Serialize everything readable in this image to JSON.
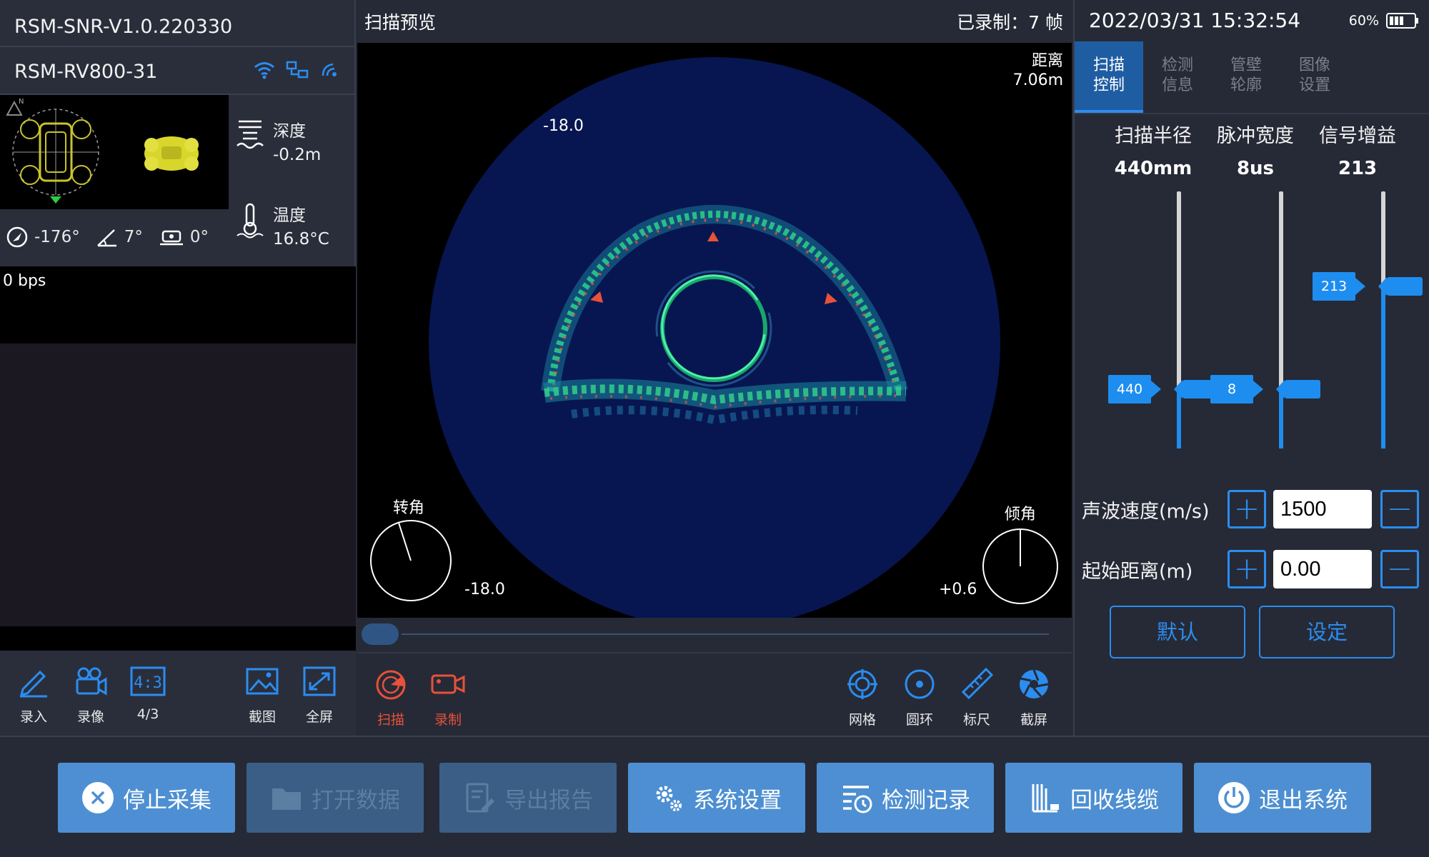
{
  "left": {
    "firmware_version": "RSM-SNR-V1.0.220330",
    "device_name": "RSM-RV800-31",
    "depth": {
      "label": "深度",
      "value": "-0.2m"
    },
    "temperature": {
      "label": "温度",
      "value": "16.8°C"
    },
    "heading": "-176°",
    "pitch": "7°",
    "roll": "0°",
    "bitrate": "0 bps",
    "toolbar": {
      "enter": "录入",
      "record": "录像",
      "aspect": "4/3",
      "aspect_icon_text": "4:3",
      "snapshot": "截图",
      "fullscreen": "全屏"
    }
  },
  "center": {
    "title": "扫描预览",
    "recorded": "已录制：7 帧",
    "distance_label": "距离",
    "distance_value": "7.06m",
    "scale_top": "-18.0",
    "rotation_label": "转角",
    "rotation_value": "-18.0",
    "tilt_label": "倾角",
    "tilt_value": "+0.6",
    "toolbar": {
      "scan": "扫描",
      "record": "录制",
      "grid": "网格",
      "ring": "圆环",
      "ruler": "标尺",
      "screenshot": "截屏"
    },
    "colors": {
      "sonar_bg": "#071650",
      "accent_red": "#e8513a"
    }
  },
  "right": {
    "datetime": "2022/03/31 15:32:54",
    "battery": "60%",
    "tabs": [
      {
        "label1": "扫描",
        "label2": "控制",
        "active": true
      },
      {
        "label1": "检测",
        "label2": "信息",
        "active": false
      },
      {
        "label1": "管壁",
        "label2": "轮廓",
        "active": false
      },
      {
        "label1": "图像",
        "label2": "设置",
        "active": false
      }
    ],
    "params": {
      "radius": {
        "label": "扫描半径",
        "value": "440mm",
        "tag": "440",
        "level": 0.23
      },
      "pulse": {
        "label": "脉冲宽度",
        "value": "8us",
        "tag": "8",
        "level": 0.23
      },
      "gain": {
        "label": "信号增益",
        "value": "213",
        "tag": "213",
        "level": 0.63
      }
    },
    "sound_speed": {
      "label": "声波速度(m/s)",
      "value": "1500"
    },
    "start_distance": {
      "label": "起始距离(m)",
      "value": "0.00"
    },
    "plus": "+",
    "minus": "−",
    "default_button": "默认",
    "set_button": "设定",
    "colors": {
      "accent": "#1e8df0",
      "active_tab": "#1f5da3"
    }
  },
  "bottom": {
    "stop": "停止采集",
    "open": "打开数据",
    "export": "导出报告",
    "settings": "系统设置",
    "records": "检测记录",
    "retract": "回收线缆",
    "exit": "退出系统",
    "colors": {
      "button": "#4d8fd2",
      "button_disabled": "#3a5e86"
    }
  }
}
